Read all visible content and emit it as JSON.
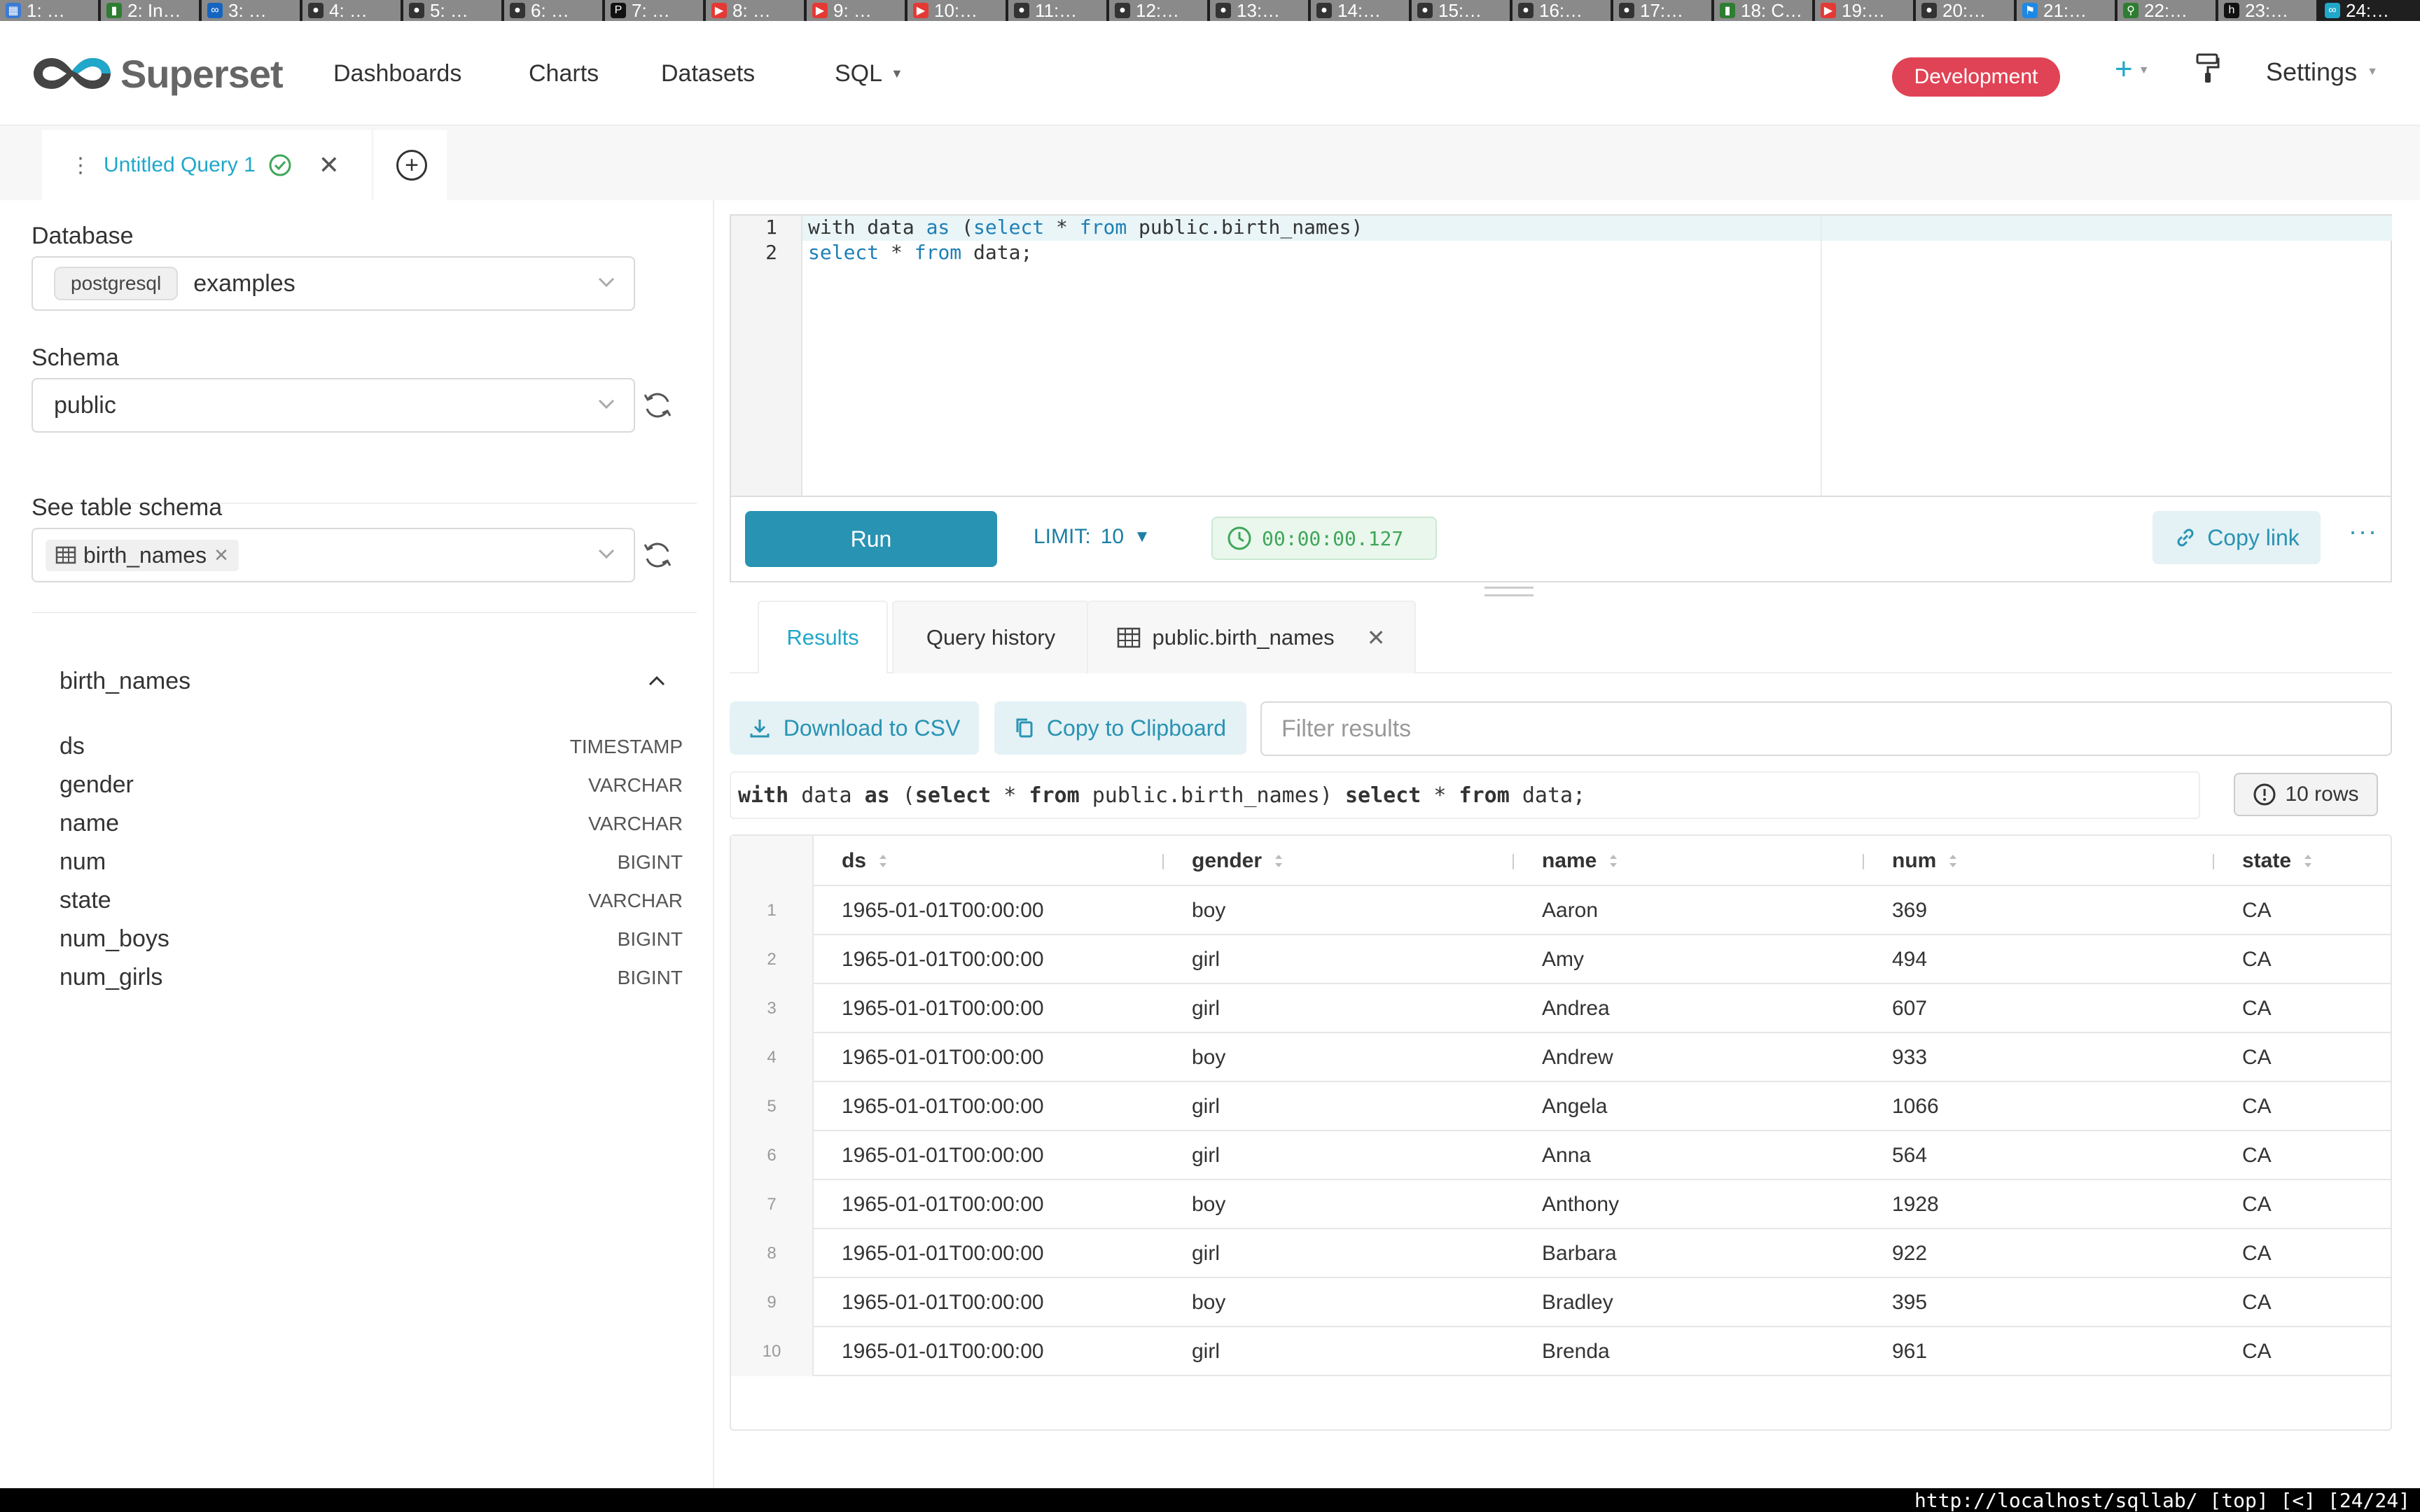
{
  "browser_tabs": [
    {
      "label": "1: …",
      "favicon": "calendar-icon",
      "color": "#3a7bd5"
    },
    {
      "label": "2: In…",
      "favicon": "bar-icon",
      "color": "#2e7d32"
    },
    {
      "label": "3: …",
      "favicon": "superset-icon",
      "color": "#1565c0"
    },
    {
      "label": "4: …",
      "favicon": "github-icon",
      "color": "#333333"
    },
    {
      "label": "5: …",
      "favicon": "github-icon",
      "color": "#333333"
    },
    {
      "label": "6: …",
      "favicon": "github-icon",
      "color": "#333333"
    },
    {
      "label": "7: …",
      "favicon": "p-icon",
      "color": "#111111"
    },
    {
      "label": "8: …",
      "favicon": "youtube-icon",
      "color": "#e53935"
    },
    {
      "label": "9: …",
      "favicon": "youtube-icon",
      "color": "#e53935"
    },
    {
      "label": "10:…",
      "favicon": "youtube-icon",
      "color": "#e53935"
    },
    {
      "label": "11:…",
      "favicon": "github-icon",
      "color": "#333333"
    },
    {
      "label": "12:…",
      "favicon": "github-icon",
      "color": "#333333"
    },
    {
      "label": "13:…",
      "favicon": "github-icon",
      "color": "#333333"
    },
    {
      "label": "14:…",
      "favicon": "github-icon",
      "color": "#333333"
    },
    {
      "label": "15:…",
      "favicon": "github-icon",
      "color": "#333333"
    },
    {
      "label": "16:…",
      "favicon": "github-icon",
      "color": "#333333"
    },
    {
      "label": "17:…",
      "favicon": "github-icon",
      "color": "#333333"
    },
    {
      "label": "18: C…",
      "favicon": "bar-icon",
      "color": "#2e7d32"
    },
    {
      "label": "19:…",
      "favicon": "youtube-icon",
      "color": "#e53935"
    },
    {
      "label": "20:…",
      "favicon": "github-icon",
      "color": "#333333"
    },
    {
      "label": "21:…",
      "favicon": "flag-icon",
      "color": "#1e88e5"
    },
    {
      "label": "22:…",
      "favicon": "link-icon",
      "color": "#2e7d32"
    },
    {
      "label": "23:…",
      "favicon": "h-icon",
      "color": "#111111"
    },
    {
      "label": "24:…",
      "favicon": "infinity-icon",
      "color": "#20a7c9"
    }
  ],
  "navbar": {
    "brand": "Superset",
    "items": [
      "Dashboards",
      "Charts",
      "Datasets",
      "SQL"
    ],
    "environment_badge": "Development",
    "settings_label": "Settings"
  },
  "query_tabs": {
    "active_label": "Untitled Query 1"
  },
  "left_panel": {
    "database_label": "Database",
    "database_engine": "postgresql",
    "database_name": "examples",
    "schema_label": "Schema",
    "schema_value": "public",
    "table_schema_label": "See table schema",
    "selected_table": "birth_names",
    "table_title": "birth_names",
    "columns": [
      {
        "name": "ds",
        "type": "TIMESTAMP"
      },
      {
        "name": "gender",
        "type": "VARCHAR"
      },
      {
        "name": "name",
        "type": "VARCHAR"
      },
      {
        "name": "num",
        "type": "BIGINT"
      },
      {
        "name": "state",
        "type": "VARCHAR"
      },
      {
        "name": "num_boys",
        "type": "BIGINT"
      },
      {
        "name": "num_girls",
        "type": "BIGINT"
      }
    ]
  },
  "editor": {
    "line_numbers": [
      "1",
      "2"
    ],
    "line1": {
      "a": "with data ",
      "kw1": "as",
      "b": " (",
      "kw2": "select",
      "c": " * ",
      "kw3": "from",
      "d": " public.birth_names)"
    },
    "line2": {
      "kw1": "select",
      "a": " * ",
      "kw2": "from",
      "b": " data;"
    }
  },
  "toolbar": {
    "run_label": "Run",
    "limit_label": "LIMIT:",
    "limit_value": "10",
    "timer": "00:00:00.127",
    "copy_link_label": "Copy link",
    "more": "···"
  },
  "results": {
    "tabs": [
      "Results",
      "Query history",
      "public.birth_names"
    ],
    "download_csv": "Download to CSV",
    "copy_clipboard": "Copy to Clipboard",
    "filter_placeholder": "Filter results",
    "executed_sql": {
      "kw1": "with",
      "a": " data ",
      "kw2": "as",
      "b": " (",
      "kw3": "select",
      "c": " * ",
      "kw4": "from",
      "d": " public.birth_names) ",
      "kw5": "select",
      "e": " * ",
      "kw6": "from",
      "f": " data;"
    },
    "row_count": "10 rows",
    "columns": [
      "ds",
      "gender",
      "name",
      "num",
      "state"
    ],
    "rows": [
      [
        "1",
        "1965-01-01T00:00:00",
        "boy",
        "Aaron",
        "369",
        "CA"
      ],
      [
        "2",
        "1965-01-01T00:00:00",
        "girl",
        "Amy",
        "494",
        "CA"
      ],
      [
        "3",
        "1965-01-01T00:00:00",
        "girl",
        "Andrea",
        "607",
        "CA"
      ],
      [
        "4",
        "1965-01-01T00:00:00",
        "boy",
        "Andrew",
        "933",
        "CA"
      ],
      [
        "5",
        "1965-01-01T00:00:00",
        "girl",
        "Angela",
        "1066",
        "CA"
      ],
      [
        "6",
        "1965-01-01T00:00:00",
        "girl",
        "Anna",
        "564",
        "CA"
      ],
      [
        "7",
        "1965-01-01T00:00:00",
        "boy",
        "Anthony",
        "1928",
        "CA"
      ],
      [
        "8",
        "1965-01-01T00:00:00",
        "girl",
        "Barbara",
        "922",
        "CA"
      ],
      [
        "9",
        "1965-01-01T00:00:00",
        "boy",
        "Bradley",
        "395",
        "CA"
      ],
      [
        "10",
        "1965-01-01T00:00:00",
        "girl",
        "Brenda",
        "961",
        "CA"
      ]
    ]
  },
  "status_bar": "http://localhost/sqllab/ [top] [<] [24/24]",
  "colors": {
    "accent": "#20a7c9",
    "run_button": "#2893b3",
    "dev_badge": "#e04355",
    "success": "#3fa659"
  }
}
